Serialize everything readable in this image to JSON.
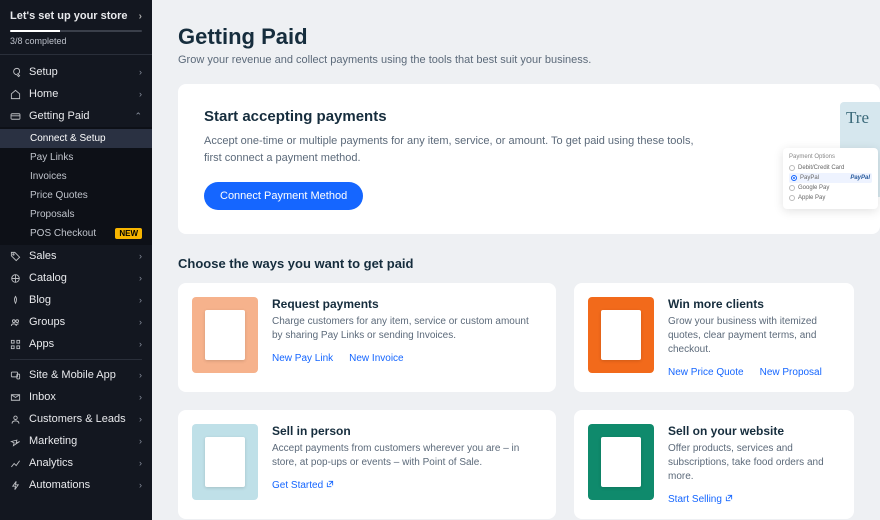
{
  "setup_banner": {
    "title": "Let's set up your store",
    "progress_text": "3/8 completed",
    "progress_pct": 37.5
  },
  "nav": [
    {
      "id": "setup",
      "label": "Setup",
      "icon": "wrench"
    },
    {
      "id": "home",
      "label": "Home",
      "icon": "home"
    },
    {
      "id": "getting-paid",
      "label": "Getting Paid",
      "icon": "card",
      "expanded": true,
      "children": [
        {
          "id": "connect",
          "label": "Connect & Setup",
          "selected": true
        },
        {
          "id": "paylinks",
          "label": "Pay Links"
        },
        {
          "id": "invoices",
          "label": "Invoices"
        },
        {
          "id": "quotes",
          "label": "Price Quotes"
        },
        {
          "id": "proposals",
          "label": "Proposals"
        },
        {
          "id": "pos",
          "label": "POS Checkout",
          "badge": "NEW"
        }
      ]
    },
    {
      "id": "sales",
      "label": "Sales",
      "icon": "tag"
    },
    {
      "id": "catalog",
      "label": "Catalog",
      "icon": "grid"
    },
    {
      "id": "blog",
      "label": "Blog",
      "icon": "pen"
    },
    {
      "id": "groups",
      "label": "Groups",
      "icon": "people"
    },
    {
      "id": "apps",
      "label": "Apps",
      "icon": "apps"
    },
    {
      "id": "site",
      "label": "Site & Mobile App",
      "icon": "device",
      "divider_before": true
    },
    {
      "id": "inbox",
      "label": "Inbox",
      "icon": "inbox"
    },
    {
      "id": "customers",
      "label": "Customers & Leads",
      "icon": "user"
    },
    {
      "id": "marketing",
      "label": "Marketing",
      "icon": "spark"
    },
    {
      "id": "analytics",
      "label": "Analytics",
      "icon": "chart"
    },
    {
      "id": "automations",
      "label": "Automations",
      "icon": "bolt"
    }
  ],
  "page": {
    "title": "Getting Paid",
    "subtitle": "Grow your revenue and collect payments using the tools that best suit your business."
  },
  "hero": {
    "title": "Start accepting payments",
    "body": "Accept one-time or multiple payments for any item, service, or amount. To get paid using these tools, first connect a payment method.",
    "cta": "Connect Payment Method",
    "mock": {
      "heading": "Payment Options",
      "opts": [
        "Debit/Credit Card",
        "PayPal",
        "Google Pay",
        "Apple Pay"
      ],
      "selected_index": 1,
      "selected_logo": "PayPal",
      "teaser": "Tre"
    }
  },
  "section_title": "Choose the ways you want to get paid",
  "cards": [
    {
      "id": "request",
      "title": "Request payments",
      "body": "Charge customers for any item, service or custom amount by sharing Pay Links or sending Invoices.",
      "thumb_bg": "#f6b28c",
      "links": [
        {
          "label": "New Pay Link"
        },
        {
          "label": "New Invoice"
        }
      ]
    },
    {
      "id": "clients",
      "title": "Win more clients",
      "body": "Grow your business with itemized quotes, clear payment terms, and checkout.",
      "thumb_bg": "#f26a1b",
      "links": [
        {
          "label": "New Price Quote"
        },
        {
          "label": "New Proposal"
        }
      ]
    },
    {
      "id": "inperson",
      "title": "Sell in person",
      "body": "Accept payments from customers wherever you are – in store, at pop-ups or events – with Point of Sale.",
      "thumb_bg": "#bfe0e8",
      "links": [
        {
          "label": "Get Started",
          "ext": true
        }
      ]
    },
    {
      "id": "website",
      "title": "Sell on your website",
      "body": "Offer products, services and subscriptions, take food orders and more.",
      "thumb_bg": "#0f8a6c",
      "links": [
        {
          "label": "Start Selling",
          "ext": true
        }
      ]
    }
  ]
}
